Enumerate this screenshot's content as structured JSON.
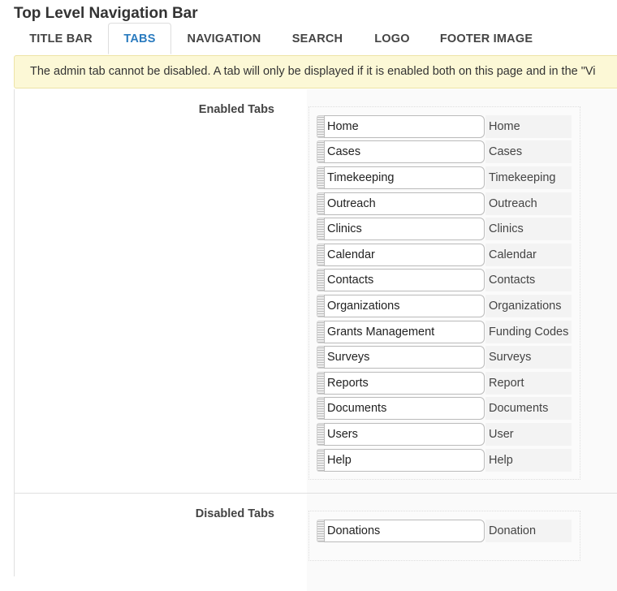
{
  "page": {
    "title": "Top Level Navigation Bar"
  },
  "tabs": [
    {
      "label": "TITLE BAR"
    },
    {
      "label": "TABS"
    },
    {
      "label": "NAVIGATION"
    },
    {
      "label": "SEARCH"
    },
    {
      "label": "LOGO"
    },
    {
      "label": "FOOTER IMAGE"
    }
  ],
  "active_tab": "TABS",
  "notice": {
    "text": "The admin tab cannot be disabled. A tab will only be displayed if it is enabled both on this page and in the \"Vi"
  },
  "enabled": {
    "label": "Enabled Tabs",
    "items": [
      {
        "value": "Home",
        "default": "Home"
      },
      {
        "value": "Cases",
        "default": "Cases"
      },
      {
        "value": "Timekeeping",
        "default": "Timekeeping"
      },
      {
        "value": "Outreach",
        "default": "Outreach"
      },
      {
        "value": "Clinics",
        "default": "Clinics"
      },
      {
        "value": "Calendar",
        "default": "Calendar"
      },
      {
        "value": "Contacts",
        "default": "Contacts"
      },
      {
        "value": "Organizations",
        "default": "Organizations"
      },
      {
        "value": "Grants Management",
        "default": "Funding Codes"
      },
      {
        "value": "Surveys",
        "default": "Surveys"
      },
      {
        "value": "Reports",
        "default": "Report"
      },
      {
        "value": "Documents",
        "default": "Documents"
      },
      {
        "value": "Users",
        "default": "User"
      },
      {
        "value": "Help",
        "default": "Help"
      }
    ]
  },
  "disabled": {
    "label": "Disabled Tabs",
    "items": [
      {
        "value": "Donations",
        "default": "Donation"
      }
    ]
  },
  "colors": {
    "active_tab": "#2a7bbf",
    "notice_bg": "#fcf8d6",
    "notice_border": "#ede3a6"
  }
}
